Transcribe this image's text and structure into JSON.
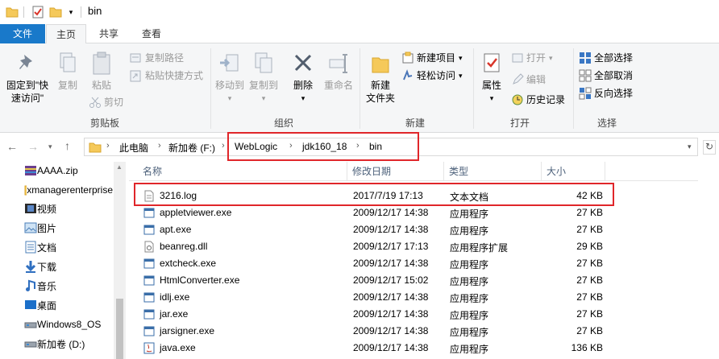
{
  "window": {
    "title": "bin"
  },
  "tabs": [
    {
      "label": "文件"
    },
    {
      "label": "主页"
    },
    {
      "label": "共享"
    },
    {
      "label": "查看"
    }
  ],
  "ribbon": {
    "clipboard": {
      "group_label": "剪贴板",
      "pin_label_1": "固定到\"快",
      "pin_label_2": "速访问\"",
      "copy": "复制",
      "paste": "粘贴",
      "copy_path": "复制路径",
      "paste_shortcut": "粘贴快捷方式",
      "cut": "剪切"
    },
    "organize": {
      "group_label": "组织",
      "move_to": "移动到",
      "copy_to": "复制到",
      "delete": "删除",
      "rename": "重命名"
    },
    "new": {
      "group_label": "新建",
      "new_folder_1": "新建",
      "new_folder_2": "文件夹",
      "new_item": "新建项目",
      "easy_access": "轻松访问"
    },
    "open": {
      "group_label": "打开",
      "properties": "属性",
      "open": "打开",
      "edit": "编辑",
      "history": "历史记录"
    },
    "select": {
      "group_label": "选择",
      "select_all": "全部选择",
      "select_none": "全部取消",
      "invert": "反向选择"
    }
  },
  "address": {
    "crumbs": [
      "此电脑",
      "新加卷 (F:)",
      "WebLogic",
      "jdk160_18",
      "bin"
    ]
  },
  "nav": [
    {
      "label": "AAAA.zip",
      "icon": "zip-icon"
    },
    {
      "label": "xmanagerenterprise",
      "icon": "folder-icon"
    },
    {
      "label": "视频",
      "icon": "video-icon"
    },
    {
      "label": "图片",
      "icon": "pictures-icon"
    },
    {
      "label": "文档",
      "icon": "documents-icon"
    },
    {
      "label": "下载",
      "icon": "download-icon"
    },
    {
      "label": "音乐",
      "icon": "music-icon"
    },
    {
      "label": "桌面",
      "icon": "desktop-icon"
    },
    {
      "label": "Windows8_OS",
      "icon": "drive-icon"
    },
    {
      "label": "新加卷 (D:)",
      "icon": "drive-icon"
    }
  ],
  "columns": {
    "name": "名称",
    "date": "修改日期",
    "type": "类型",
    "size": "大小"
  },
  "files": [
    {
      "name": "3216.log",
      "date": "2017/7/19 17:13",
      "type": "文本文档",
      "size": "42 KB",
      "icon": "text-file-icon"
    },
    {
      "name": "appletviewer.exe",
      "date": "2009/12/17 14:38",
      "type": "应用程序",
      "size": "27 KB",
      "icon": "exe-icon"
    },
    {
      "name": "apt.exe",
      "date": "2009/12/17 14:38",
      "type": "应用程序",
      "size": "27 KB",
      "icon": "exe-icon"
    },
    {
      "name": "beanreg.dll",
      "date": "2009/12/17 17:13",
      "type": "应用程序扩展",
      "size": "29 KB",
      "icon": "dll-icon"
    },
    {
      "name": "extcheck.exe",
      "date": "2009/12/17 14:38",
      "type": "应用程序",
      "size": "27 KB",
      "icon": "exe-icon"
    },
    {
      "name": "HtmlConverter.exe",
      "date": "2009/12/17 15:02",
      "type": "应用程序",
      "size": "27 KB",
      "icon": "exe-icon"
    },
    {
      "name": "idlj.exe",
      "date": "2009/12/17 14:38",
      "type": "应用程序",
      "size": "27 KB",
      "icon": "exe-icon"
    },
    {
      "name": "jar.exe",
      "date": "2009/12/17 14:38",
      "type": "应用程序",
      "size": "27 KB",
      "icon": "exe-icon"
    },
    {
      "name": "jarsigner.exe",
      "date": "2009/12/17 14:38",
      "type": "应用程序",
      "size": "27 KB",
      "icon": "exe-icon"
    },
    {
      "name": "java.exe",
      "date": "2009/12/17 14:38",
      "type": "应用程序",
      "size": "136 KB",
      "icon": "java-icon"
    }
  ]
}
